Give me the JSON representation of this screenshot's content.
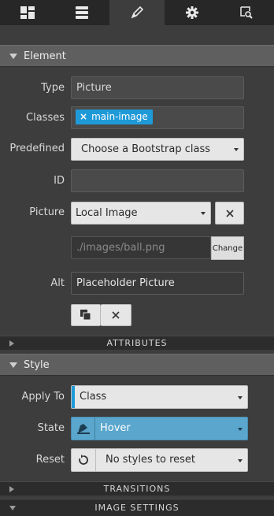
{
  "toolbar": {
    "tabs": [
      {
        "icon": "layout-icon"
      },
      {
        "icon": "list-icon"
      },
      {
        "icon": "brush-icon",
        "active": true
      },
      {
        "icon": "gear-icon"
      },
      {
        "icon": "inspect-icon"
      }
    ]
  },
  "element": {
    "title": "Element",
    "type_label": "Type",
    "type_value": "Picture",
    "classes_label": "Classes",
    "class_tag": "main-image",
    "class_tag_remove": "×",
    "predefined_label": "Predefined",
    "predefined_value": "Choose a Bootstrap class",
    "id_label": "ID",
    "id_value": "",
    "picture_label": "Picture",
    "picture_source": "Local Image",
    "picture_path": "./images/ball.png",
    "change_label": "Change",
    "alt_label": "Alt",
    "alt_value": "Placeholder Picture"
  },
  "attributes": {
    "title": "ATTRIBUTES"
  },
  "style": {
    "title": "Style",
    "apply_label": "Apply To",
    "apply_value": "Class",
    "state_label": "State",
    "state_value": "Hover",
    "reset_label": "Reset",
    "reset_value": "No styles to reset"
  },
  "transitions": {
    "title": "TRANSITIONS"
  },
  "image_settings": {
    "title": "IMAGE SETTINGS"
  },
  "colors": {
    "accent": "#1f9ad8",
    "state": "#5aa6cc",
    "panel": "#3d3d3d",
    "toolbar": "#272727"
  }
}
